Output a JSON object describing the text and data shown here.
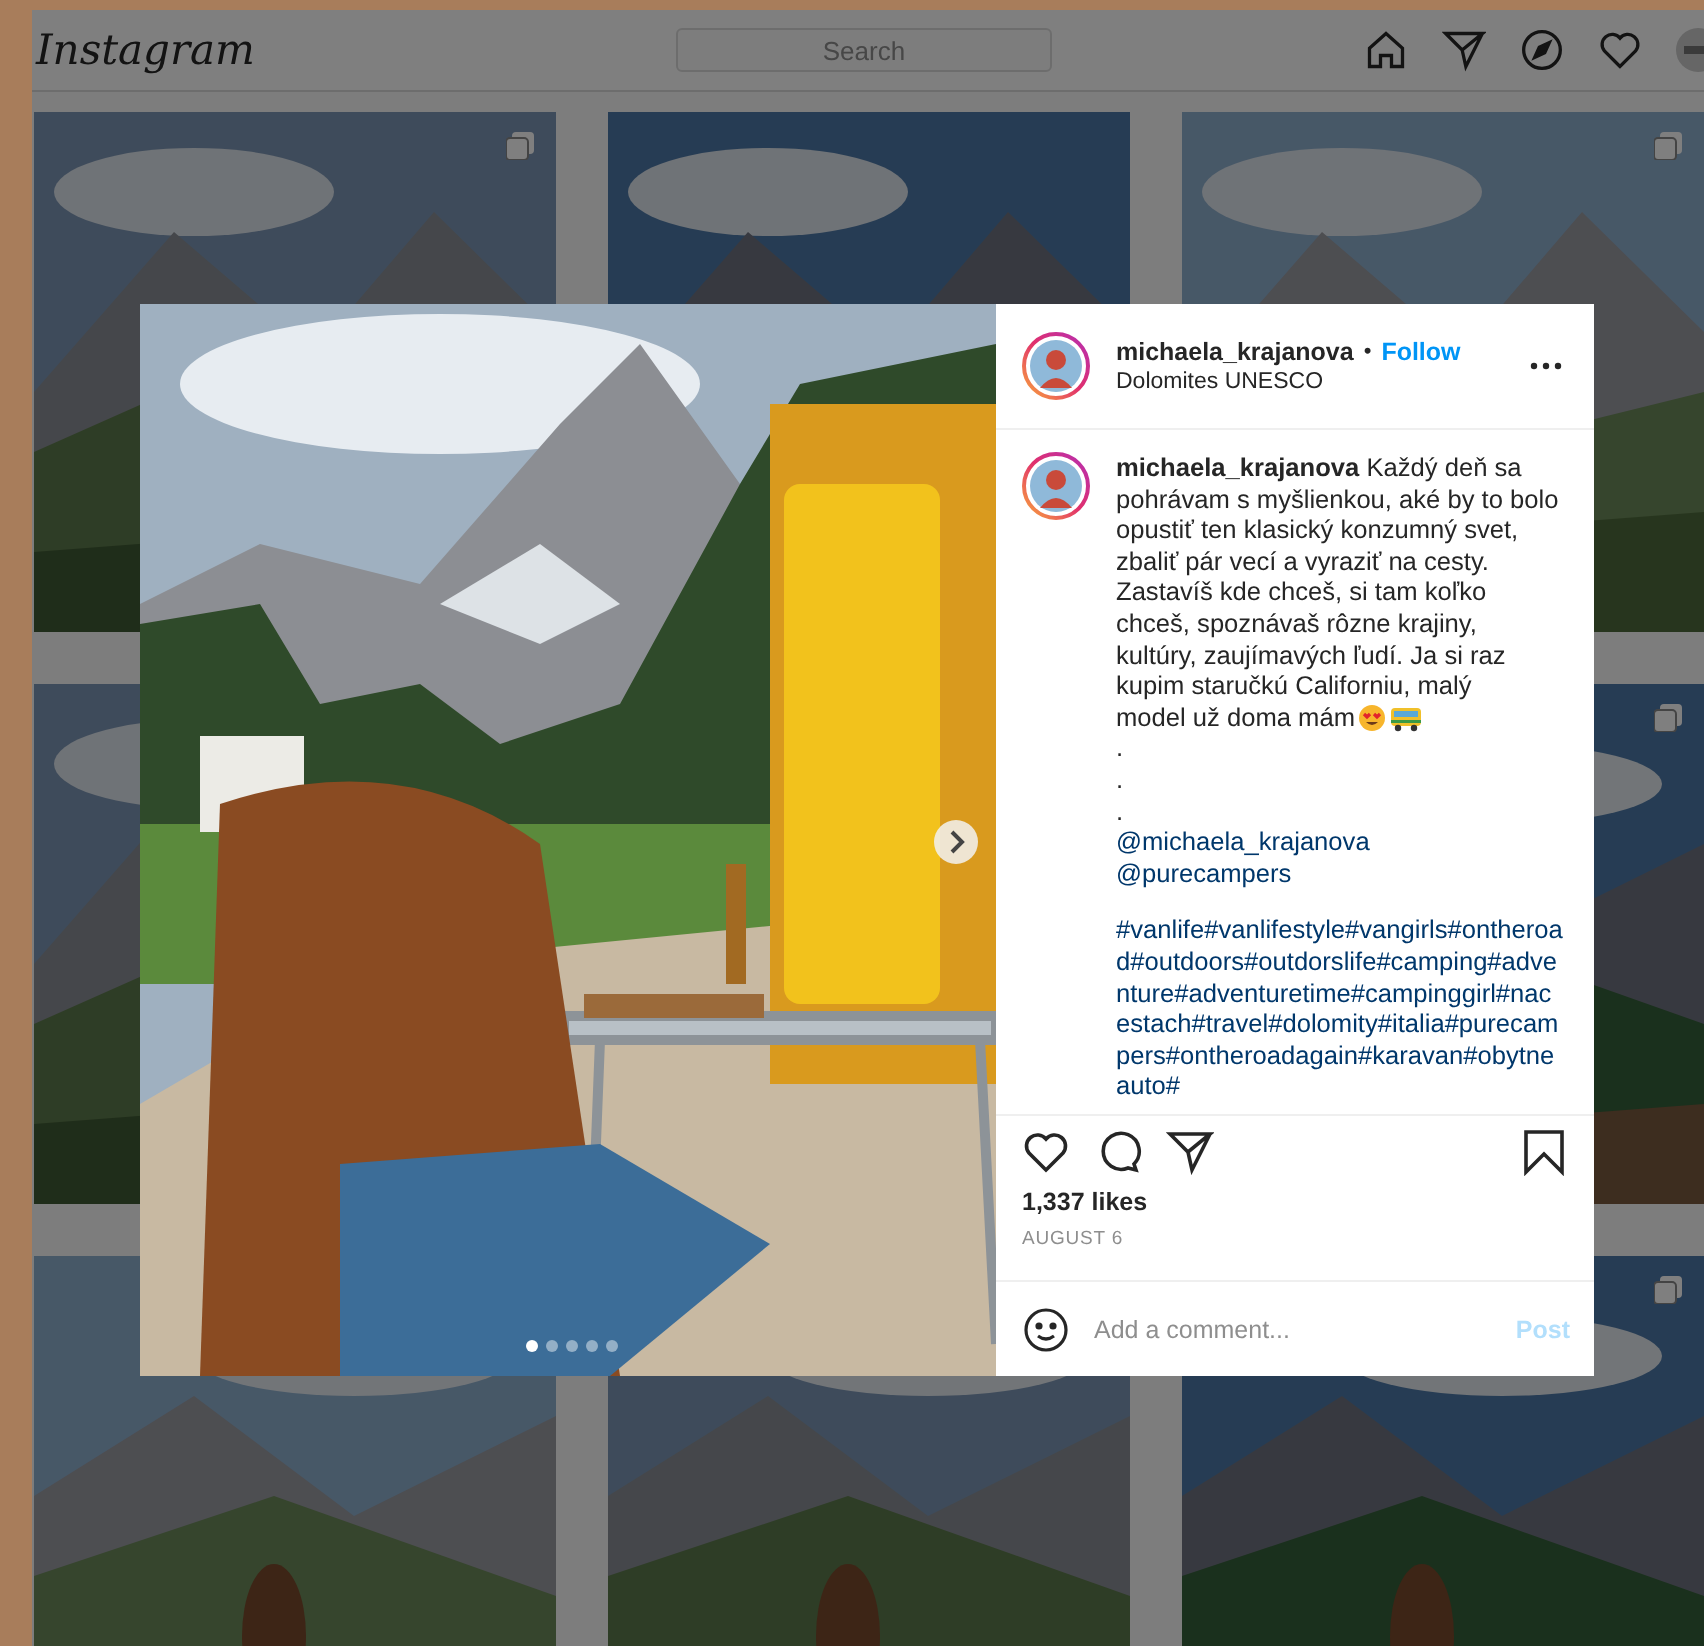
{
  "header": {
    "logo": "Instagram",
    "search": {
      "placeholder": "Search"
    }
  },
  "feed": {
    "tiles": [
      {
        "kind": "picture",
        "multiple": true
      },
      {
        "kind": "picture",
        "multiple": false
      },
      {
        "kind": "picture",
        "multiple": true
      },
      {
        "kind": "picture"
      },
      {
        "kind": "picture",
        "multiple": true
      },
      {
        "kind": "picture"
      },
      {
        "kind": "picture"
      },
      {
        "kind": "picture",
        "multiple": true
      }
    ]
  },
  "post": {
    "author": "michaela_krajanova",
    "separator": "•",
    "follow": "Follow",
    "location": "Dolomites UNESCO",
    "slides": [
      {
        "selected": true
      },
      {
        "selected": false
      },
      {
        "selected": false
      },
      {
        "selected": false
      },
      {
        "selected": false
      }
    ],
    "caption": "**michaela_krajanova** Každý deň sa pohrávam s myšlienkou, aké by to bolo opustiť ten klasický konzumný svet, zbaliť pár vecí a vyraziť na cesty. Zastavíš kde chceš, si tam koľko chceš, spoznávaš rôzne krajiny, kultúry, zaujímavých ľudí. Ja si raz kupim staručkú Californiu, malý",
    "caption_end": "model už doma mám",
    "dots": [
      ".",
      ".",
      "."
    ],
    "mentions": [
      "@michaela_krajanova",
      "@purecampers"
    ],
    "hashtags": "#vanlife#vanlifestyle#vangirls#ontheroad#outdoors#outdorslife#camping#adventure#adventuretime#campinggirl#nacestach#travel#dolomity#italia#purecampers#ontheroadagain#karavan#obytneauto#",
    "likes": "1,337 likes",
    "date": "AUGUST 6",
    "comment": {
      "placeholder": "Add a comment..."
    },
    "post_button": {
      "label": "Post",
      "disabled": true
    }
  }
}
